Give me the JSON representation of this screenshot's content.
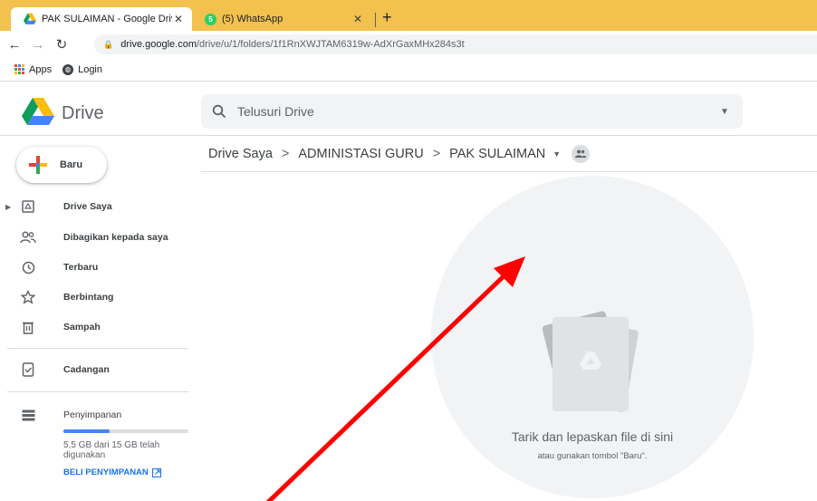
{
  "browser": {
    "tabs": [
      {
        "title": "PAK SULAIMAN - Google Drive",
        "active": true
      },
      {
        "title": "(5) WhatsApp",
        "active": false
      }
    ],
    "whatsapp_count": "5",
    "url_host": "drive.google.com",
    "url_path": "/drive/u/1/folders/1f1RnXWJTAM6319w-AdXrGaxMHx284s3t",
    "bookmarks": [
      {
        "label": "Apps",
        "icon": "apps-grid-icon"
      },
      {
        "label": "Login",
        "icon": "globe-icon"
      }
    ],
    "tab_color": "#f2c14e"
  },
  "drive": {
    "app_name": "Drive",
    "search_placeholder": "Telusuri Drive",
    "new_button_label": "Baru",
    "nav_items": [
      {
        "label": "Drive Saya",
        "icon": "my-drive-icon"
      },
      {
        "label": "Dibagikan kepada saya",
        "icon": "shared-icon"
      },
      {
        "label": "Terbaru",
        "icon": "clock-icon"
      },
      {
        "label": "Berbintang",
        "icon": "star-icon"
      },
      {
        "label": "Sampah",
        "icon": "trash-icon"
      },
      {
        "label": "Cadangan",
        "icon": "backup-icon"
      },
      {
        "label": "Penyimpanan",
        "icon": "storage-icon"
      }
    ],
    "storage": {
      "used_fraction": 0.367,
      "text": "5,5 GB dari 15 GB telah digunakan",
      "buy_label": "BELI PENYIMPANAN"
    },
    "breadcrumb": [
      "Drive Saya",
      "ADMINISTASI GURU",
      "PAK SULAIMAN"
    ],
    "empty_state": {
      "title": "Tarik dan lepaskan file di sini",
      "subtitle": "atau gunakan tombol \"Baru\"."
    },
    "annotation_color": "#ff0000"
  }
}
